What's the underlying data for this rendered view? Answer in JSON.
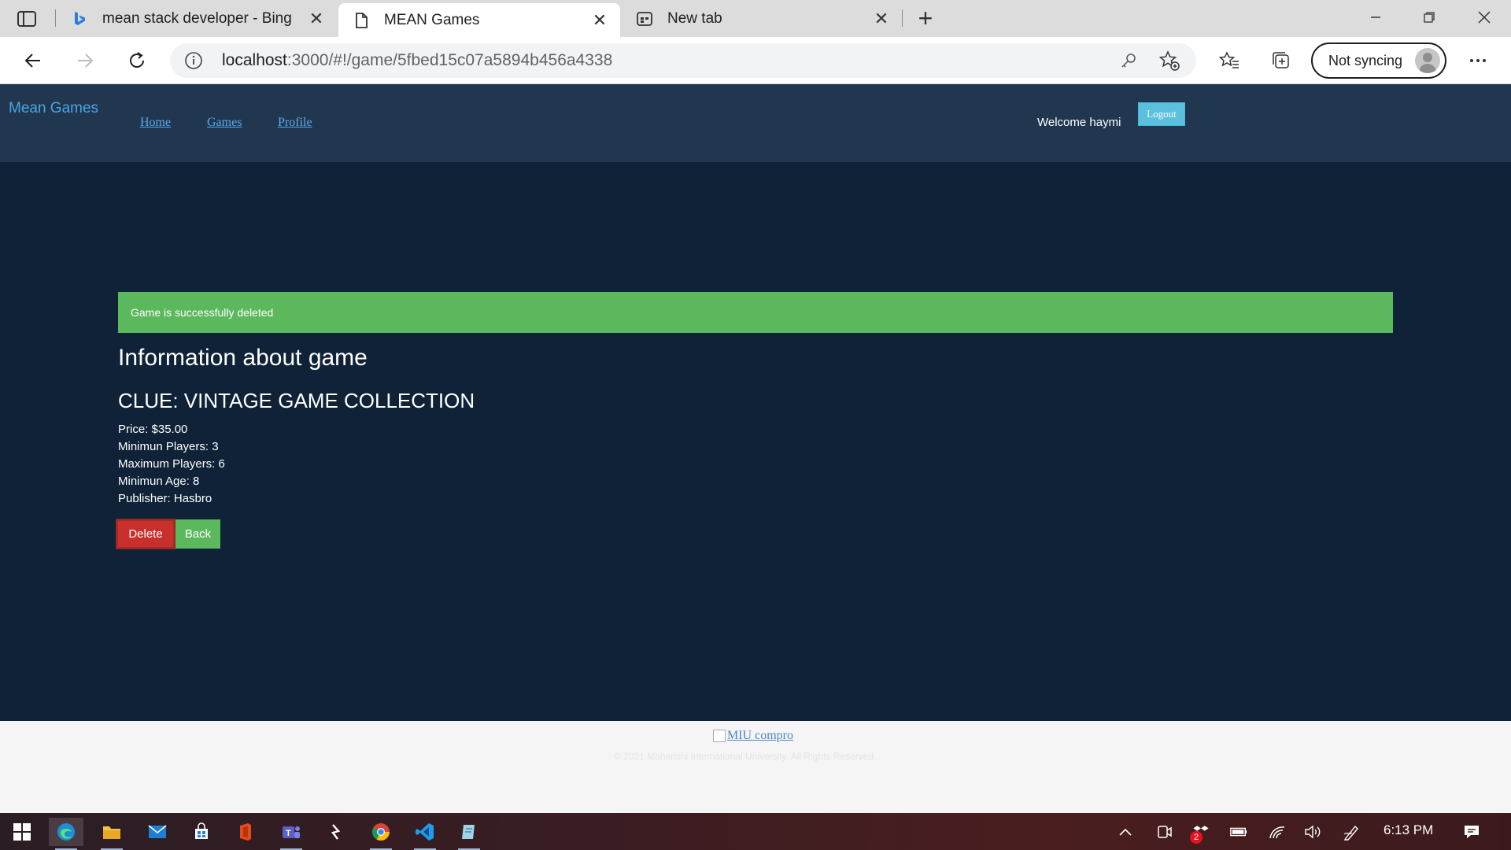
{
  "browser": {
    "tabs": [
      {
        "title": "mean stack developer - Bing",
        "icon": "bing-icon"
      },
      {
        "title": "MEAN Games",
        "icon": "page-icon"
      },
      {
        "title": "New tab",
        "icon": "newtab-icon"
      }
    ],
    "close_glyph": "✕",
    "new_tab_glyph": "+",
    "url_host": "localhost",
    "url_path": ":3000/#!/game/5fbed15c07a5894b456a4338",
    "sync_label": "Not syncing"
  },
  "navbar": {
    "brand": "Mean Games",
    "links": [
      {
        "label": "Home"
      },
      {
        "label": "Games"
      },
      {
        "label": "Profile"
      }
    ],
    "welcome": "Welcome haymi",
    "logout_label": "Logout"
  },
  "main": {
    "alert": "Game is successfully deleted",
    "heading": "Information about game",
    "game_title": "CLUE: VINTAGE GAME COLLECTION",
    "details": [
      "Price: $35.00",
      "Minimun Players: 3",
      "Maximum Players: 6",
      "Minimun Age: 8",
      "Publisher: Hasbro"
    ],
    "delete_label": "Delete",
    "back_label": "Back"
  },
  "footer": {
    "logo_alt": "MIU compro",
    "copyright": "© 2021 Maharishi International University. All Rights Reserved."
  },
  "taskbar": {
    "notification_badge": "2",
    "clock": "6:13 PM"
  },
  "colors": {
    "navbar_bg": "#20374f",
    "page_bg": "#0f2238",
    "success": "#5cb85c",
    "danger": "#c9302c",
    "info": "#5bc0de",
    "link": "#5aa9ea"
  }
}
